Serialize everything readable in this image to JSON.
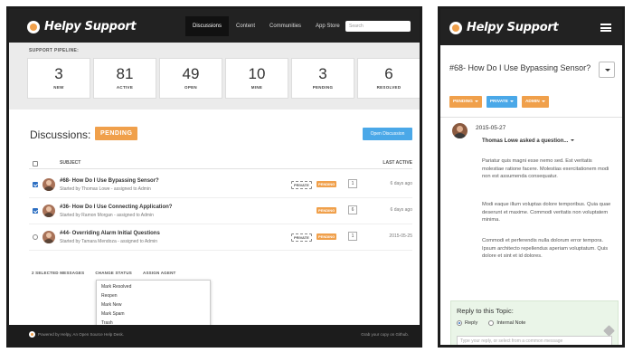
{
  "brand": {
    "name": "Helpy Support"
  },
  "desktop": {
    "nav": {
      "links": [
        "Discussions",
        "Content",
        "Communities",
        "App Store"
      ],
      "active": "Discussions",
      "search_placeholder": "Search"
    },
    "pipeline": {
      "label": "SUPPORT PIPELINE:",
      "stats": [
        {
          "value": "3",
          "label": "NEW"
        },
        {
          "value": "81",
          "label": "ACTIVE"
        },
        {
          "value": "49",
          "label": "OPEN"
        },
        {
          "value": "10",
          "label": "MINE"
        },
        {
          "value": "3",
          "label": "PENDING"
        },
        {
          "value": "6",
          "label": "RESOLVED"
        }
      ]
    },
    "discussions": {
      "title": "Discussions:",
      "status_badge": "PENDING",
      "open_button": "Open Discussion",
      "columns": {
        "subject": "SUBJECT",
        "last_active": "LAST ACTIVE"
      },
      "rows": [
        {
          "title": "#68- How Do I Use Bypassing Sensor?",
          "sub": "Started by Thomas Lowe - assigned to Admin",
          "private": "PRIVATE",
          "pending": "PENDING",
          "count": "1",
          "date": "6 days ago",
          "checked": true
        },
        {
          "title": "#36- How Do I Use Connecting Application?",
          "sub": "Started by Ramon Morgan - assigned to Admin",
          "private": "",
          "pending": "PENDING",
          "count": "6",
          "date": "6 days ago",
          "checked": true
        },
        {
          "title": "#44- Overriding Alarm Initial Questions",
          "sub": "Started by Tamara Mendoza - assigned to Admin",
          "private": "PRIVATE",
          "pending": "PENDING",
          "count": "1",
          "date": "2015-05-25",
          "checked": false
        }
      ],
      "bulk": {
        "selected": "2 SELECTED MESSAGES",
        "change_status": "CHANGE STATUS",
        "assign_agent": "ASSIGN AGENT"
      },
      "status_menu": [
        "Mark Resolved",
        "Reopen",
        "Mark New",
        "Mark Spam",
        "Trash"
      ]
    },
    "footer": {
      "left": "Powered by Helpy, An Open Source Help Desk.",
      "right": "Grab your copy on Github."
    }
  },
  "mobile": {
    "topic_title": "#68- How Do I Use Bypassing Sensor?",
    "tags": [
      {
        "label": "PENDING",
        "color": "#f0a04b"
      },
      {
        "label": "PRIVATE",
        "color": "#4aa8e8"
      },
      {
        "label": "ADMIN",
        "color": "#f0a04b"
      }
    ],
    "post": {
      "date": "2015-05-27",
      "author": "Thomas Lowe asked a question...",
      "paragraphs": [
        "Pariatur quis magni esse nemo sed. Est veritatis molestiae ratione facere. Molestias exercitationem modi non est assumenda consequatur.",
        "Modi eaque illum voluptas dolore temporibus. Quia quae deserunt et maxime. Commodi veritatis non voluptatem minima.",
        "Commodi et perferendis nulla dolorum error tempora. Ipsum architecto repellendus aperiam voluptatum. Quis dolore et sint et id dolores."
      ]
    },
    "reply": {
      "title": "Reply to this Topic:",
      "options": [
        "Reply",
        "Internal Note"
      ],
      "placeholder": "Type your reply, or select from a common message"
    }
  },
  "colors": {
    "accent_orange": "#f0a04b",
    "accent_blue": "#4aa8e8",
    "nav_dark": "#222222",
    "reply_bg": "#eaf5e8"
  }
}
